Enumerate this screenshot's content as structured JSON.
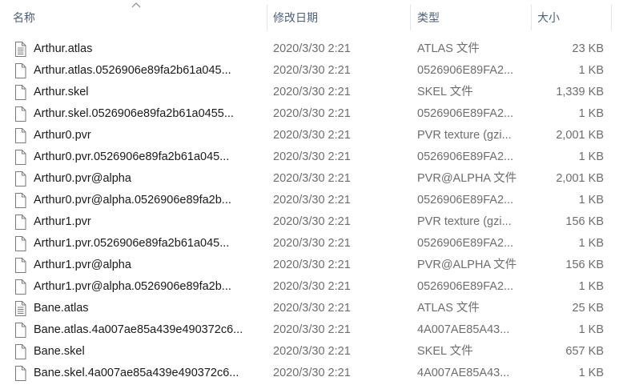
{
  "columns": {
    "name": "名称",
    "date": "修改日期",
    "type": "类型",
    "size": "大小"
  },
  "files": [
    {
      "name": "Arthur.atlas",
      "date": "2020/3/30 2:21",
      "type": "ATLAS 文件",
      "size": "23 KB",
      "icon": "text-file-icon"
    },
    {
      "name": "Arthur.atlas.0526906e89fa2b61a045...",
      "date": "2020/3/30 2:21",
      "type": "0526906E89FA2...",
      "size": "1 KB",
      "icon": "blank-file-icon"
    },
    {
      "name": "Arthur.skel",
      "date": "2020/3/30 2:21",
      "type": "SKEL 文件",
      "size": "1,339 KB",
      "icon": "blank-file-icon"
    },
    {
      "name": "Arthur.skel.0526906e89fa2b61a0455...",
      "date": "2020/3/30 2:21",
      "type": "0526906E89FA2...",
      "size": "1 KB",
      "icon": "blank-file-icon"
    },
    {
      "name": "Arthur0.pvr",
      "date": "2020/3/30 2:21",
      "type": "PVR texture (gzi...",
      "size": "2,001 KB",
      "icon": "blank-file-icon"
    },
    {
      "name": "Arthur0.pvr.0526906e89fa2b61a045...",
      "date": "2020/3/30 2:21",
      "type": "0526906E89FA2...",
      "size": "1 KB",
      "icon": "blank-file-icon"
    },
    {
      "name": "Arthur0.pvr@alpha",
      "date": "2020/3/30 2:21",
      "type": "PVR@ALPHA 文件",
      "size": "2,001 KB",
      "icon": "blank-file-icon"
    },
    {
      "name": "Arthur0.pvr@alpha.0526906e89fa2b...",
      "date": "2020/3/30 2:21",
      "type": "0526906E89FA2...",
      "size": "1 KB",
      "icon": "blank-file-icon"
    },
    {
      "name": "Arthur1.pvr",
      "date": "2020/3/30 2:21",
      "type": "PVR texture (gzi...",
      "size": "156 KB",
      "icon": "blank-file-icon"
    },
    {
      "name": "Arthur1.pvr.0526906e89fa2b61a045...",
      "date": "2020/3/30 2:21",
      "type": "0526906E89FA2...",
      "size": "1 KB",
      "icon": "blank-file-icon"
    },
    {
      "name": "Arthur1.pvr@alpha",
      "date": "2020/3/30 2:21",
      "type": "PVR@ALPHA 文件",
      "size": "156 KB",
      "icon": "blank-file-icon"
    },
    {
      "name": "Arthur1.pvr@alpha.0526906e89fa2b...",
      "date": "2020/3/30 2:21",
      "type": "0526906E89FA2...",
      "size": "1 KB",
      "icon": "blank-file-icon"
    },
    {
      "name": "Bane.atlas",
      "date": "2020/3/30 2:21",
      "type": "ATLAS 文件",
      "size": "25 KB",
      "icon": "text-file-icon"
    },
    {
      "name": "Bane.atlas.4a007ae85a439e490372c6...",
      "date": "2020/3/30 2:21",
      "type": "4A007AE85A43...",
      "size": "1 KB",
      "icon": "blank-file-icon"
    },
    {
      "name": "Bane.skel",
      "date": "2020/3/30 2:21",
      "type": "SKEL 文件",
      "size": "657 KB",
      "icon": "blank-file-icon"
    },
    {
      "name": "Bane.skel.4a007ae85a439e490372c6...",
      "date": "2020/3/30 2:21",
      "type": "4A007AE85A43...",
      "size": "1 KB",
      "icon": "blank-file-icon"
    }
  ]
}
